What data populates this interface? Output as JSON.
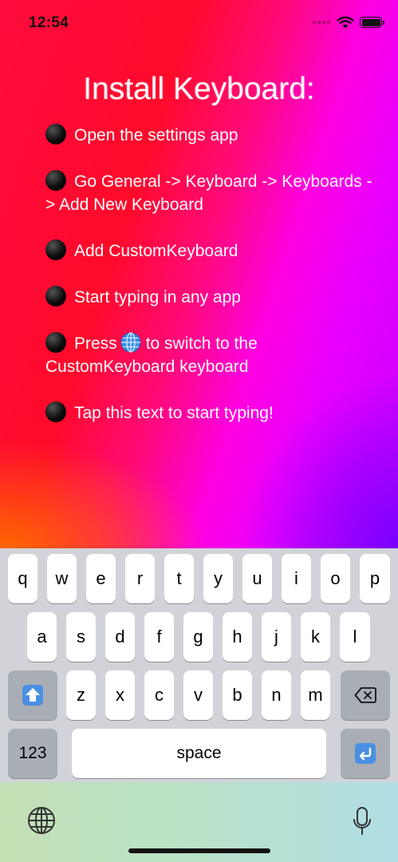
{
  "status_bar": {
    "time": "12:54",
    "icons": [
      "cellular-dots-icon",
      "wifi-icon",
      "battery-icon"
    ]
  },
  "title": "Install Keyboard:",
  "steps": [
    {
      "text": "Open the settings app"
    },
    {
      "text": "Go General -> Keyboard -> Keyboards -> Add New Keyboard"
    },
    {
      "text": "Add CustomKeyboard"
    },
    {
      "text": "Start typing in any app"
    },
    {
      "text_before": "Press",
      "text_after": "to switch to the CustomKeyboard keyboard"
    },
    {
      "text": "Tap this text to start typing!"
    }
  ],
  "keyboard": {
    "row1": [
      "q",
      "w",
      "e",
      "r",
      "t",
      "y",
      "u",
      "i",
      "o",
      "p"
    ],
    "row2": [
      "a",
      "s",
      "d",
      "f",
      "g",
      "h",
      "j",
      "k",
      "l"
    ],
    "row3": [
      "z",
      "x",
      "c",
      "v",
      "b",
      "n",
      "m"
    ],
    "numbers_label": "123",
    "space_label": "space",
    "icons": {
      "shift": "shift-icon",
      "delete": "delete-icon",
      "return": "return-icon",
      "globe": "globe-icon",
      "mic": "microphone-icon"
    }
  },
  "colors": {
    "gradient_red": "#ff0b3f",
    "gradient_magenta": "#ff00e0",
    "gradient_purple": "#7800ff",
    "gradient_orange": "#ff6e00",
    "keyboard_bg": "#d1d3d9",
    "key_bg": "#ffffff",
    "function_key_bg": "#a9adb6",
    "accent_blue": "#3b8ee8"
  }
}
